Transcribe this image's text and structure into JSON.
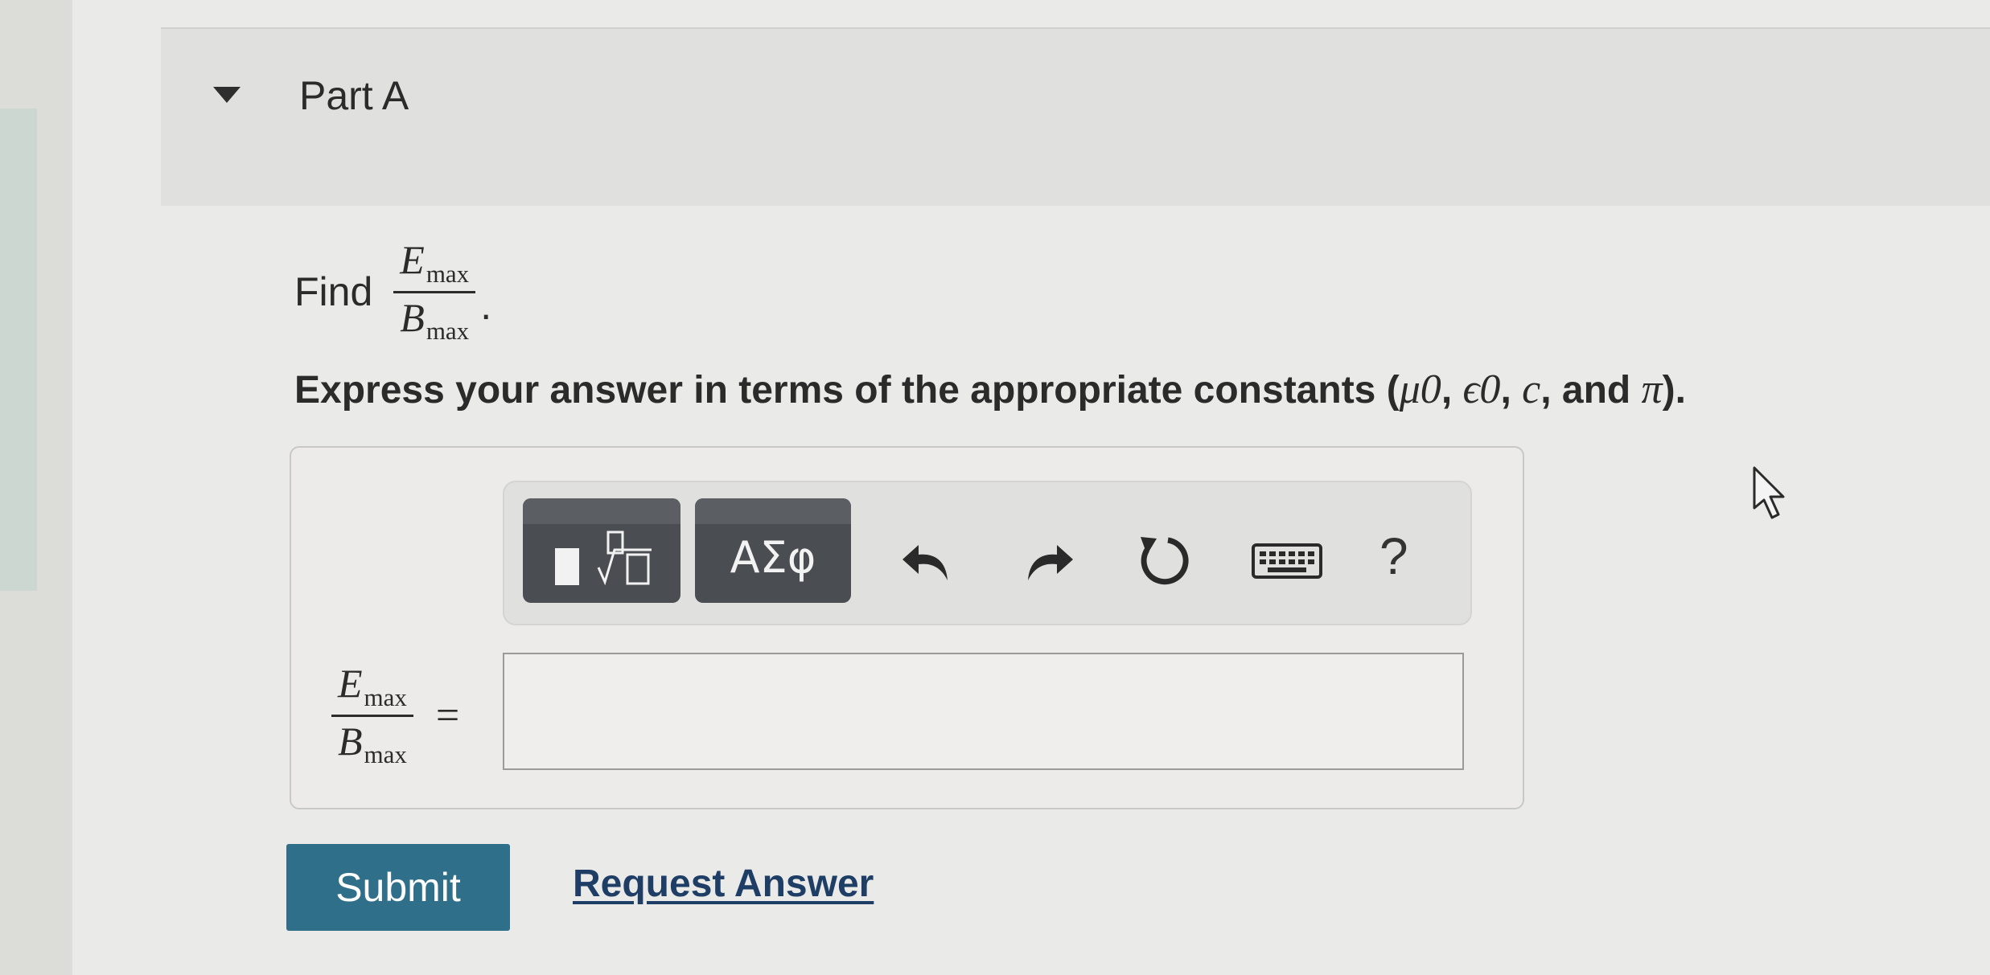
{
  "part": {
    "title": "Part A"
  },
  "prompt": {
    "find_word": "Find",
    "fraction": {
      "numerator": "E",
      "numerator_sub": "max",
      "denominator": "B",
      "denominator_sub": "max"
    },
    "period": "."
  },
  "instruction": {
    "text": "Express your answer in terms of the appropriate constants (",
    "mu0": "μ0",
    "sep1": ", ",
    "eps0": "ϵ0",
    "sep2": ", ",
    "c": "c",
    "sep3": ", and ",
    "pi": "π",
    "close": ")."
  },
  "toolbar": {
    "greek_label": "ΑΣφ",
    "help_label": "?"
  },
  "equation": {
    "numerator": "E",
    "numerator_sub": "max",
    "denominator": "B",
    "denominator_sub": "max",
    "equals": "=",
    "answer_value": ""
  },
  "actions": {
    "submit_label": "Submit",
    "request_label": "Request Answer"
  },
  "colors": {
    "submit_bg": "#2f6f8a",
    "link": "#1f3e66",
    "toolbar_button": "#4a4d52"
  }
}
